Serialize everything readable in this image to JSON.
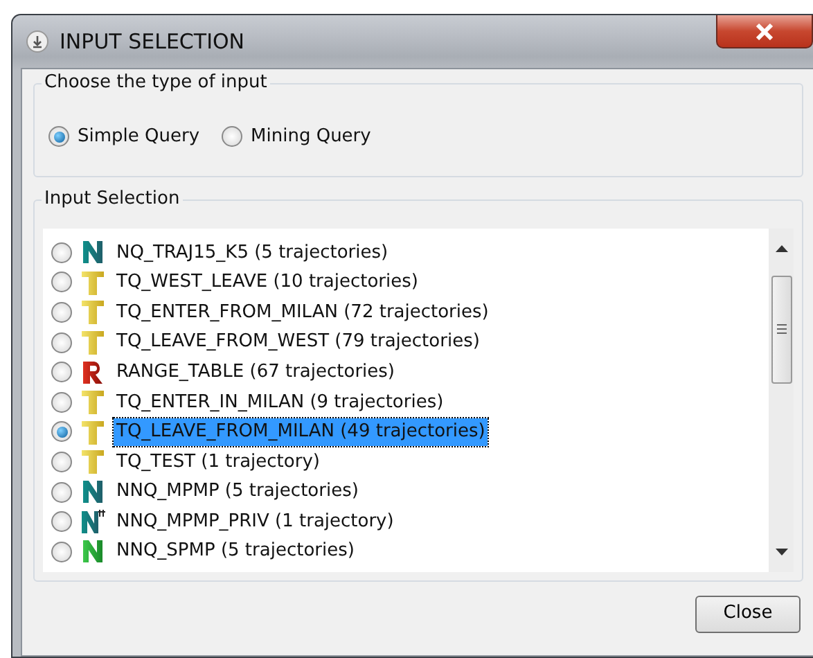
{
  "window": {
    "title": "INPUT SELECTION"
  },
  "input_type": {
    "legend": "Choose the type of input",
    "options": [
      {
        "label": "Simple Query",
        "selected": true
      },
      {
        "label": "Mining Query",
        "selected": false
      }
    ]
  },
  "input_selection": {
    "legend": "Input Selection",
    "items": [
      {
        "kind": "nq",
        "label": "NQ_TRAJ15_K5 (5 trajectories)",
        "selected": false
      },
      {
        "kind": "tq",
        "label": "TQ_WEST_LEAVE (10 trajectories)",
        "selected": false
      },
      {
        "kind": "tq",
        "label": "TQ_ENTER_FROM_MILAN (72 trajectories)",
        "selected": false
      },
      {
        "kind": "tq",
        "label": "TQ_LEAVE_FROM_WEST (79 trajectories)",
        "selected": false
      },
      {
        "kind": "range",
        "label": "RANGE_TABLE (67 trajectories)",
        "selected": false
      },
      {
        "kind": "tq",
        "label": "TQ_ENTER_IN_MILAN (9 trajectories)",
        "selected": false
      },
      {
        "kind": "tq",
        "label": "TQ_LEAVE_FROM_MILAN (49 trajectories)",
        "selected": true
      },
      {
        "kind": "tq",
        "label": "TQ_TEST (1 trajectory)",
        "selected": false
      },
      {
        "kind": "nq",
        "label": "NNQ_MPMP (5 trajectories)",
        "selected": false
      },
      {
        "kind": "nq-priv",
        "label": "NNQ_MPMP_PRIV (1 trajectory)",
        "selected": false
      },
      {
        "kind": "nq-green",
        "label": "NNQ_SPMP (5 trajectories)",
        "selected": false
      }
    ]
  },
  "buttons": [
    {
      "label": "Close"
    }
  ]
}
